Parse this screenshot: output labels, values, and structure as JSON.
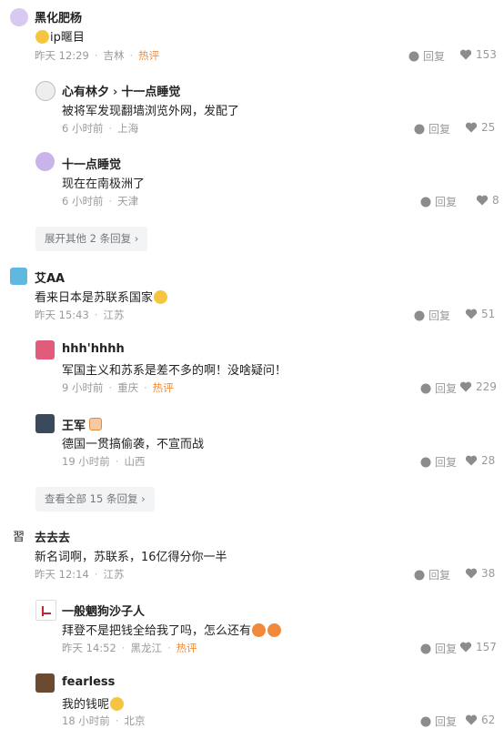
{
  "comments": [
    {
      "name": "黑化肥杨",
      "text": "ip暱目",
      "time": "昨天 12:29",
      "location": "吉林",
      "hot": "热评",
      "reply": "回复",
      "likes": "153"
    },
    {
      "name": "心有林夕",
      "to": "十一点睡觉",
      "text": "被将军发现翻墙浏览外网，发配了",
      "time": "6 小时前",
      "location": "上海",
      "reply": "回复",
      "likes": "25"
    },
    {
      "name": "十一点睡觉",
      "text": "现在在南极洲了",
      "time": "6 小时前",
      "location": "天津",
      "reply": "回复",
      "likes": "8"
    },
    {
      "name": "艾AA",
      "text": "看来日本是苏联系国家",
      "time": "昨天 15:43",
      "location": "江苏",
      "reply": "回复",
      "likes": "51"
    },
    {
      "name": "hhh'hhhh",
      "text": "军国主义和苏系是差不多的啊！没啥疑问！",
      "time": "9 小时前",
      "location": "重庆",
      "hot": "热评",
      "reply": "回复",
      "likes": "229"
    },
    {
      "name": "王军",
      "text": "德国一贯搞偷袭，不宣而战",
      "time": "19 小时前",
      "location": "山西",
      "reply": "回复",
      "likes": "28"
    },
    {
      "name": "去去去",
      "text": "新名词啊，苏联系，16亿得分你一半",
      "time": "昨天 12:14",
      "location": "江苏",
      "reply": "回复",
      "likes": "38"
    },
    {
      "name": "一般魍狗沙子人",
      "text": "拜登不是把钱全给我了吗，怎么还有",
      "time": "昨天 14:52",
      "location": "黑龙江",
      "hot": "热评",
      "reply": "回复",
      "likes": "157"
    },
    {
      "name": "fearless",
      "text": "我的钱呢",
      "time": "18 小时前",
      "location": "北京",
      "reply": "回复",
      "likes": "62"
    }
  ],
  "expand": {
    "first": "展开其他 2 条回复 ›",
    "second": "查看全部 15 条回复 ›"
  },
  "colors": {
    "hot": "#f28c3a",
    "meta": "#9a9a9a",
    "expand_bg": "#f3f4f6"
  }
}
